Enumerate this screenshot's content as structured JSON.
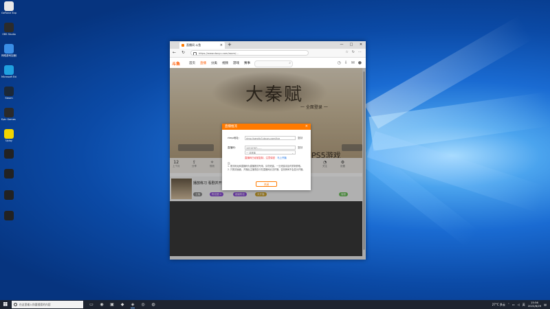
{
  "desktop": {
    "icons": [
      {
        "name": "app-icon-1",
        "label": "GeForce Experience",
        "color": "#e8e8e8"
      },
      {
        "name": "app-icon-2",
        "label": "OBS Studio",
        "color": "#2b2b2b"
      },
      {
        "name": "app-icon-3",
        "label": "网络游戏加速器",
        "color": "#3a8ee6"
      },
      {
        "name": "app-icon-4",
        "label": "Microsoft Edge",
        "color": "#1fa0e0"
      },
      {
        "name": "app-icon-5",
        "label": "Steam",
        "color": "#1b2838"
      },
      {
        "name": "app-icon-6",
        "label": "Epic Games Launcher",
        "color": "#2a2a2a"
      },
      {
        "name": "app-icon-7",
        "label": "Uplay",
        "color": "#f2d500"
      },
      {
        "name": "file-icon-1",
        "label": "",
        "color": "#222"
      },
      {
        "name": "file-icon-2",
        "label": "",
        "color": "#222"
      },
      {
        "name": "file-icon-3",
        "label": "",
        "color": "#222"
      },
      {
        "name": "file-icon-4",
        "label": "",
        "color": "#222"
      }
    ]
  },
  "browser": {
    "tab_title": "直播间 斗鱼",
    "url": "https://www.douyu.com/room/...",
    "window_controls": [
      "—",
      "□",
      "✕"
    ],
    "new_tab": "+",
    "tools": [
      "☆",
      "↻",
      "⋯"
    ]
  },
  "site": {
    "logo": "斗鱼",
    "nav": [
      "首页",
      "直播",
      "分类",
      "视频",
      "游戏",
      "赛事"
    ],
    "active_nav": 1,
    "banner_calligraphy": "大秦赋",
    "banner_sub": "一 全面登录 一",
    "banner_ps5": "PS5游戏",
    "stats": [
      {
        "value": "12",
        "label": "上个月"
      },
      {
        "value": "",
        "label": "分享"
      },
      {
        "value": "",
        "label": "规则"
      },
      {
        "value": "",
        "label": "礼物"
      },
      {
        "value": "",
        "label": "关注"
      },
      {
        "value": "",
        "label": "设置"
      }
    ],
    "anchor_name": "播放练习 看剧并开播",
    "pills": [
      "主播",
      "粉丝团 4",
      "超级粉丝",
      "未开播",
      "客服"
    ]
  },
  "dialog": {
    "title": "直播推流",
    "rtmp_label": "rtmp地址:",
    "rtmp_value": "rtmp://sendtc3.douyu.com/live",
    "copy1": "复制",
    "key_label": "直播码:",
    "key_value": "10315767……",
    "copy2": "复制",
    "select_value": "一 请选择",
    "warning": "直播码已经被复制，注意保密",
    "warning_link": "马上开播",
    "notes_title": "注:",
    "notes": [
      "1. 推流地址和直播码为直播推流专用，请勿泄露，一旦泄露请及时重新获取。",
      "2. 只推流画面，开播后主播需自行在直播间点击开播，否则房间不会显示开播。"
    ],
    "confirm": "关闭"
  },
  "taskbar": {
    "search_placeholder": "在这里输入你要搜索的内容",
    "apps": [
      "▭",
      "◉",
      "▣",
      "◆",
      "◈",
      "◎",
      "◍"
    ],
    "weather": "27°C 多云",
    "lang": "英",
    "time": "15:56",
    "date": "2022/8/29"
  }
}
